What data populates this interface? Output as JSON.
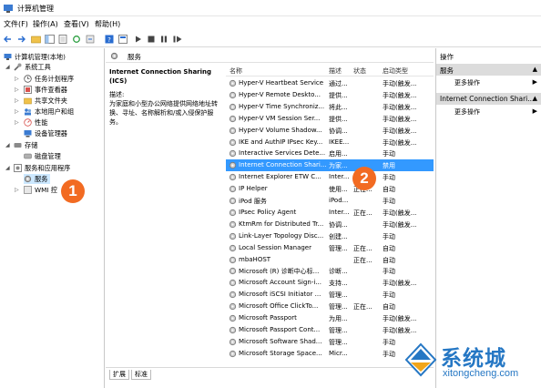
{
  "window": {
    "title": "计算机管理"
  },
  "menu": [
    "文件(F)",
    "操作(A)",
    "查看(V)",
    "帮助(H)"
  ],
  "tree": {
    "root": "计算机管理(本地)",
    "system_tools": "系统工具",
    "task_scheduler": "任务计划程序",
    "event_viewer": "事件查看器",
    "shared_folders": "共享文件夹",
    "local_users": "本地用户和组",
    "performance": "性能",
    "device_manager": "设备管理器",
    "storage": "存储",
    "disk_management": "磁盘管理",
    "services_apps": "服务和应用程序",
    "services": "服务",
    "wmi": "WMI 控"
  },
  "center": {
    "header": "服务",
    "selected_service_name": "Internet Connection Sharing (ICS)",
    "desc_label": "描述:",
    "desc_text": "为家庭和小型办公网络提供网络地址转换、寻址、名称解析和/或入侵保护服务。",
    "columns": {
      "name": "名称",
      "desc": "描述",
      "status": "状态",
      "startup": "启动类型"
    },
    "rows": [
      {
        "name": "Hyper-V Heartbeat Service",
        "desc": "通过...",
        "status": "",
        "startup": "手动(触发..."
      },
      {
        "name": "Hyper-V Remote Deskto...",
        "desc": "提供...",
        "status": "",
        "startup": "手动(触发..."
      },
      {
        "name": "Hyper-V Time Synchroniz...",
        "desc": "将此...",
        "status": "",
        "startup": "手动(触发..."
      },
      {
        "name": "Hyper-V VM Session Ser...",
        "desc": "提供...",
        "status": "",
        "startup": "手动(触发..."
      },
      {
        "name": "Hyper-V Volume Shadow...",
        "desc": "协调...",
        "status": "",
        "startup": "手动(触发..."
      },
      {
        "name": "IKE and AuthIP IPsec Key...",
        "desc": "IKEE...",
        "status": "",
        "startup": "手动(触发..."
      },
      {
        "name": "Interactive Services Dete...",
        "desc": "启用...",
        "status": "",
        "startup": "手动"
      },
      {
        "name": "Internet Connection Shari...",
        "desc": "为家...",
        "status": "",
        "startup": "禁用"
      },
      {
        "name": "Internet Explorer ETW C...",
        "desc": "Inter...",
        "status": "",
        "startup": "手动"
      },
      {
        "name": "IP Helper",
        "desc": "使用...",
        "status": "正在...",
        "startup": "自动"
      },
      {
        "name": "iPod 服务",
        "desc": "iPod...",
        "status": "",
        "startup": "手动"
      },
      {
        "name": "IPsec Policy Agent",
        "desc": "Inter...",
        "status": "正在...",
        "startup": "手动(触发..."
      },
      {
        "name": "KtmRm for Distributed Tr...",
        "desc": "协调...",
        "status": "",
        "startup": "手动(触发..."
      },
      {
        "name": "Link-Layer Topology Disc...",
        "desc": "创建...",
        "status": "",
        "startup": "手动"
      },
      {
        "name": "Local Session Manager",
        "desc": "管理...",
        "status": "正在...",
        "startup": "自动"
      },
      {
        "name": "mbaHOST",
        "desc": "",
        "status": "正在...",
        "startup": "自动"
      },
      {
        "name": "Microsoft (R) 诊断中心标...",
        "desc": "诊断...",
        "status": "",
        "startup": "手动"
      },
      {
        "name": "Microsoft Account Sign-i...",
        "desc": "支持...",
        "status": "",
        "startup": "手动(触发..."
      },
      {
        "name": "Microsoft iSCSI Initiator ...",
        "desc": "管理...",
        "status": "",
        "startup": "手动"
      },
      {
        "name": "Microsoft Office ClickTo...",
        "desc": "管理...",
        "status": "正在...",
        "startup": "自动"
      },
      {
        "name": "Microsoft Passport",
        "desc": "为用...",
        "status": "",
        "startup": "手动(触发..."
      },
      {
        "name": "Microsoft Passport Cont...",
        "desc": "管理...",
        "status": "",
        "startup": "手动(触发..."
      },
      {
        "name": "Microsoft Software Shad...",
        "desc": "管理...",
        "status": "",
        "startup": "手动"
      },
      {
        "name": "Microsoft Storage Space...",
        "desc": "Micr...",
        "status": "",
        "startup": "手动"
      }
    ],
    "tabs": [
      "扩展",
      "标准"
    ]
  },
  "actions": {
    "title": "操作",
    "section1": "服务",
    "more1": "更多操作",
    "section2": "Internet Connection Shari...",
    "more2": "更多操作"
  },
  "badges": {
    "one": "1",
    "two": "2"
  },
  "watermark": {
    "cn": "系统城",
    "en": "xitongcheng.com"
  },
  "colors": {
    "selection": "#3399ff",
    "badge": "#f26b22",
    "brand": "#2577c4"
  }
}
